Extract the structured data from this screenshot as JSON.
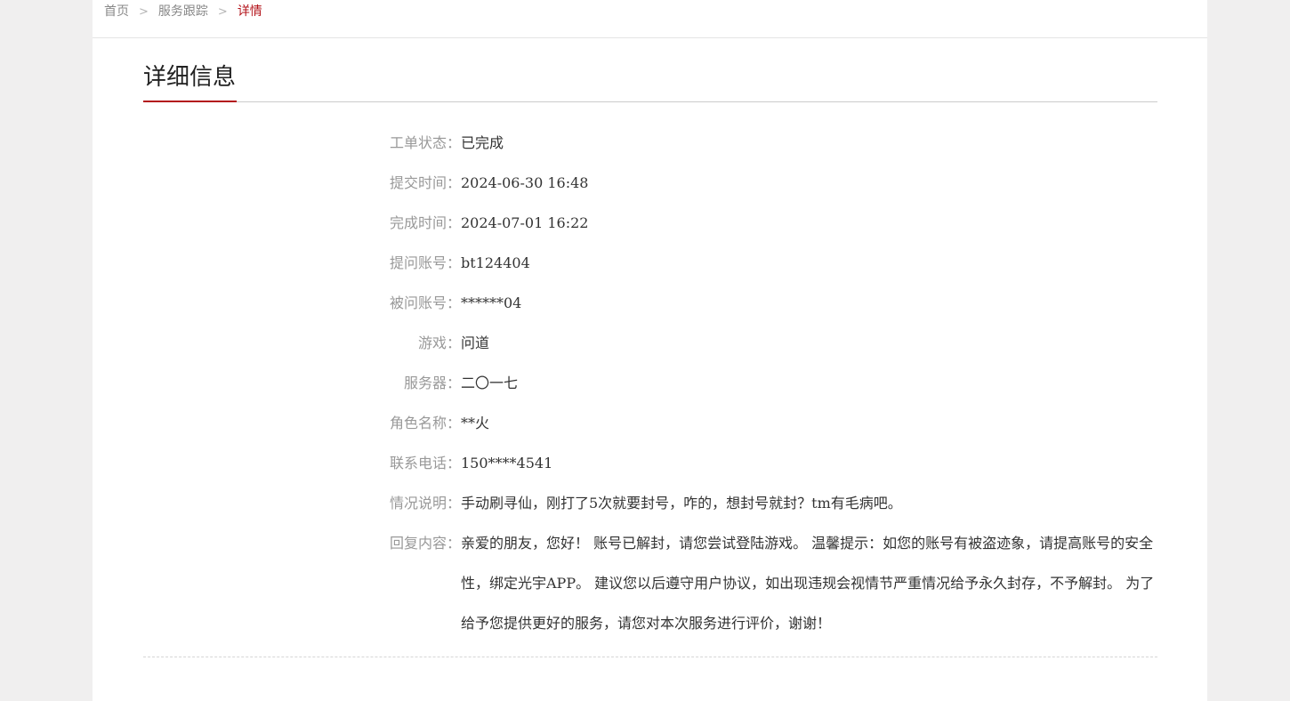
{
  "breadcrumb": {
    "home": "首页",
    "service_tracking": "服务跟踪",
    "current": "详情",
    "separator": ">"
  },
  "section": {
    "title": "详细信息"
  },
  "details": [
    {
      "label": "工单状态：",
      "value": "已完成"
    },
    {
      "label": "提交时间：",
      "value": "2024-06-30 16:48"
    },
    {
      "label": "完成时间：",
      "value": "2024-07-01 16:22"
    },
    {
      "label": "提问账号：",
      "value": "bt124404"
    },
    {
      "label": "被问账号：",
      "value": "******04"
    },
    {
      "label": "游戏：",
      "value": "问道"
    },
    {
      "label": "服务器：",
      "value": "二〇一七"
    },
    {
      "label": "角色名称：",
      "value": "**火"
    },
    {
      "label": "联系电话：",
      "value": "150****4541"
    },
    {
      "label": "情况说明：",
      "value": "手动刷寻仙，刚打了5次就要封号，咋的，想封号就封？tm有毛病吧。"
    },
    {
      "label": "回复内容：",
      "value": "亲爱的朋友，您好！ 账号已解封，请您尝试登陆游戏。 温馨提示：如您的账号有被盗迹象，请提高账号的安全性，绑定光宇APP。 建议您以后遵守用户协议，如出现违规会视情节严重情况给予永久封存，不予解封。 为了给予您提供更好的服务，请您对本次服务进行评价，谢谢！"
    }
  ],
  "colors": {
    "accent": "#b3141b",
    "label_text": "#999999",
    "value_text": "#333333",
    "page_background": "#f0efef"
  }
}
